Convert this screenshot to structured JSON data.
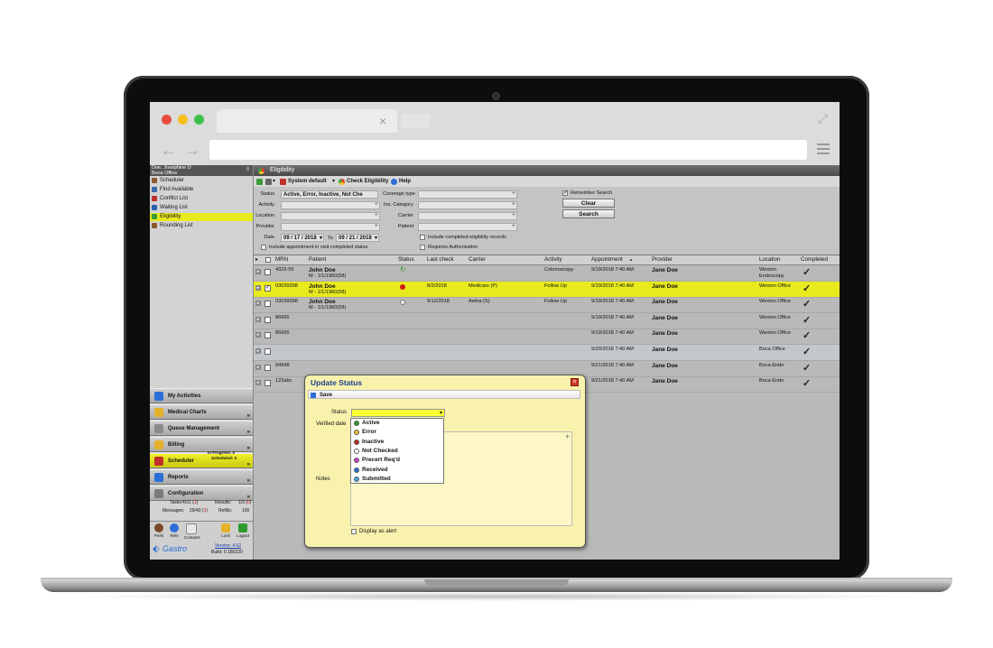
{
  "browser": {
    "tab_close": "×"
  },
  "user": {
    "name": "Doe, Josephine D",
    "office": "Boca Office"
  },
  "nav": [
    {
      "label": "Scheduler",
      "color": "#8a5a2a"
    },
    {
      "label": "Find Available",
      "color": "#3a6ab0"
    },
    {
      "label": "Conflict List",
      "color": "#c0302a"
    },
    {
      "label": "Waiting List",
      "color": "#2a5fb0"
    },
    {
      "label": "Eligibility",
      "color": "#3a9a3a"
    },
    {
      "label": "Rounding List",
      "color": "#8a5a2a"
    }
  ],
  "modules": [
    {
      "label": "My Activities"
    },
    {
      "label": "Medical Charts"
    },
    {
      "label": "Queue Management"
    },
    {
      "label": "Billing"
    },
    {
      "label": "Scheduler",
      "in_progress": "In Progress: 0",
      "scheduled": "Scheduled: 0"
    },
    {
      "label": "Reports"
    },
    {
      "label": "Configuration"
    }
  ],
  "stats": {
    "tasks_label": "Tasks:",
    "tasks_value": "4/31 (",
    "tasks_red": "1",
    "tasks_close": ")",
    "results_label": "Results:",
    "results_value": "1/3 (",
    "results_red": "0",
    "results_close": ")",
    "messages_label": "Messages:",
    "messages_value": "29/40 (",
    "messages_red": "1",
    "messages_close": ")",
    "refills_label": "Refills:",
    "refills_value": "100"
  },
  "bottom_buttons": [
    "Prefs",
    "Refs",
    "Contacts",
    "Lock",
    "Logout"
  ],
  "footer": {
    "brand": "Gastro",
    "version": "Version: 4.62",
    "build": "Build: 0.180220"
  },
  "header": {
    "title": "Eligibility"
  },
  "toolbar": {
    "system_default": "System default",
    "check_eligibility": "Check Eligibility",
    "help": "Help"
  },
  "filters": {
    "status_label": "Status",
    "status_value": "Active, Error, Inactive, Not Che",
    "activity_label": "Activity",
    "location_label": "Location",
    "provider_label": "Provider",
    "date_label": "Date",
    "date_from": "09 / 17 / 2018",
    "to_label": "To",
    "date_to": "09 / 21 / 2018",
    "include_visit": "Include appointment in visit completed status",
    "coverage_label": "Coverage type",
    "ins_category_label": "Ins. Category",
    "carrier_label": "Carrier",
    "patient_label": "Patient",
    "include_completed": "Include completed eligibility records",
    "requires_auth": "Requires Authorization",
    "remember_search": "Remember Search",
    "clear": "Clear",
    "search": "Search"
  },
  "grid": {
    "columns": [
      "MRN",
      "Patient",
      "Status",
      "Last check",
      "Carrier",
      "Activity",
      "Appointment",
      "Provider",
      "Location",
      "Completed"
    ],
    "sort_arrow": "▲",
    "rows": [
      {
        "mrn": "4322-55",
        "patient": "John Doe",
        "sub": "M - 1/1/1960(58)",
        "status": "refresh",
        "last_check": "",
        "carrier": "",
        "activity": "Colonoscopy",
        "appointment": "9/19/2018 7:40 AM",
        "provider": "Jane Doe",
        "location": "Weston",
        "location2": "Endoscopy"
      },
      {
        "mrn": "03039398",
        "patient": "John Doe",
        "sub": "M - 1/1/1960(58)",
        "status": "red",
        "last_check": "8/2/2018",
        "carrier": "Medicare (P)",
        "activity": "Follow Up",
        "appointment": "9/19/2018 7:40 AM",
        "provider": "Jane Doe",
        "location": "Weston Office",
        "location2": ""
      },
      {
        "mrn": "03039398",
        "patient": "John Doe",
        "sub": "M - 1/1/1960(58)",
        "status": "grey",
        "last_check": "9/12/2018",
        "carrier": "Aetna (S)",
        "activity": "Follow Up",
        "appointment": "9/19/2018 7:40 AM",
        "provider": "Jane Doe",
        "location": "Weston Office",
        "location2": ""
      },
      {
        "mrn": "86665",
        "patient": "",
        "sub": "",
        "status": "",
        "last_check": "",
        "carrier": "",
        "activity": "",
        "appointment": "9/19/2018 7:40 AM",
        "provider": "Jane Doe",
        "location": "Weston Office",
        "location2": ""
      },
      {
        "mrn": "86665",
        "patient": "",
        "sub": "",
        "status": "",
        "last_check": "",
        "carrier": "",
        "activity": "",
        "appointment": "9/19/2018 7:40 AM",
        "provider": "Jane Doe",
        "location": "Weston Office",
        "location2": ""
      },
      {
        "mrn": "",
        "patient": "",
        "sub": "",
        "status": "",
        "last_check": "",
        "carrier": "",
        "activity": "",
        "appointment": "9/20/2018 7:40 AM",
        "provider": "Jane Doe",
        "location": "Boca Office",
        "location2": ""
      },
      {
        "mrn": "94948",
        "patient": "",
        "sub": "",
        "status": "",
        "last_check": "",
        "carrier": "",
        "activity": "",
        "appointment": "9/21/2018 7:40 AM",
        "provider": "Jane Doe",
        "location": "Boca Endo",
        "location2": ""
      },
      {
        "mrn": "123abc",
        "patient": "",
        "sub": "",
        "status": "",
        "last_check": "",
        "carrier": "",
        "activity": "",
        "appointment": "9/21/2018 7:40 AM",
        "provider": "Jane Doe",
        "location": "Boca Endo",
        "location2": ""
      }
    ]
  },
  "dialog": {
    "title": "Update Status",
    "close": "×",
    "save": "Save",
    "status_label": "Status",
    "verified_label": "Verified date",
    "notes_label": "Notes",
    "display_alert": "Display as alert",
    "options": [
      {
        "label": "Active",
        "color": "#2e9a2e"
      },
      {
        "label": "Error",
        "color": "#f2c12e"
      },
      {
        "label": "Inactive",
        "color": "#c42a1a"
      },
      {
        "label": "Not Checked",
        "color": "#ffffff"
      },
      {
        "label": "Precert Req'd",
        "color": "#d13ad1"
      },
      {
        "label": "Received",
        "color": "#2a6fd6"
      },
      {
        "label": "Submitted",
        "color": "#4aa8e0"
      }
    ]
  }
}
